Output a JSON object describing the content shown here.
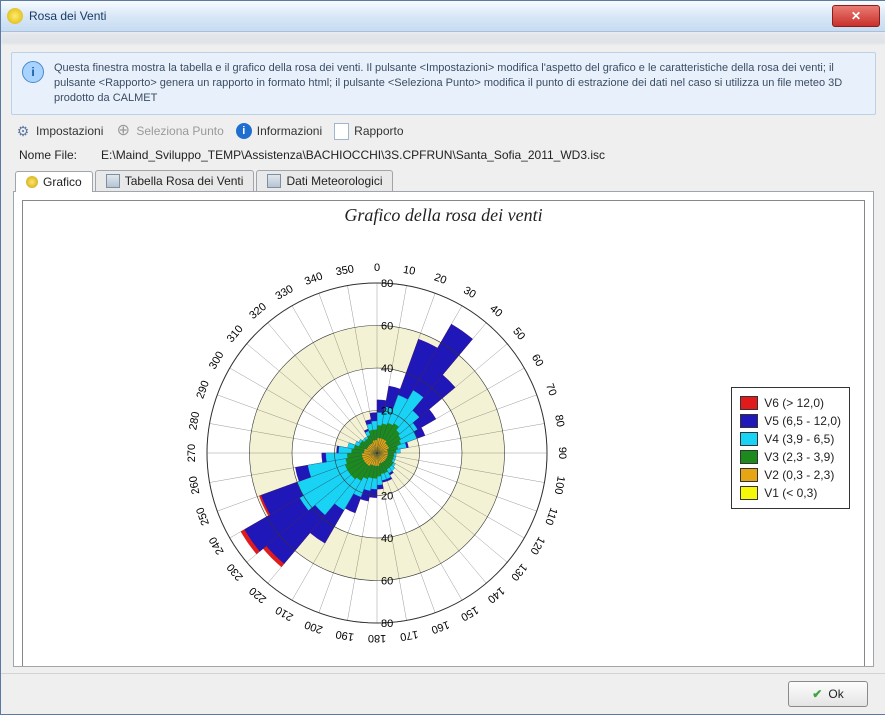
{
  "window": {
    "title": "Rosa dei Venti"
  },
  "info": {
    "text": "Questa finestra mostra la tabella e il grafico della rosa dei venti. Il pulsante <Impostazioni> modifica l'aspetto del grafico e le caratteristiche della rosa dei venti; il pulsante <Rapporto> genera un rapporto in formato html; il pulsante <Seleziona Punto> modifica il punto di estrazione dei dati nel caso si utilizza un file meteo 3D prodotto da CALMET"
  },
  "toolbar": {
    "impostazioni": "Impostazioni",
    "seleziona": "Seleziona Punto",
    "informazioni": "Informazioni",
    "rapporto": "Rapporto"
  },
  "file": {
    "label": "Nome File:",
    "path": "E:\\Maind_Sviluppo_TEMP\\Assistenza\\BACHIOCCHI\\3S.CPFRUN\\Santa_Sofia_2011_WD3.isc"
  },
  "tabs": {
    "grafico": "Grafico",
    "tabella": "Tabella Rosa dei Venti",
    "meteo": "Dati Meteorologici"
  },
  "chart_title": "Grafico della rosa dei venti",
  "legend": [
    {
      "name": "V6 (> 12,0)",
      "color": "#e11b1b"
    },
    {
      "name": "V5 (6,5 - 12,0)",
      "color": "#2017b9"
    },
    {
      "name": "V4 (3,9 - 6,5)",
      "color": "#18d3f4"
    },
    {
      "name": "V3 (2,3 - 3,9)",
      "color": "#1c8a1c"
    },
    {
      "name": "V2 (0,3 - 2,3)",
      "color": "#e6a514"
    },
    {
      "name": "V1 (< 0,3)",
      "color": "#f6f60a"
    }
  ],
  "footer": {
    "ok": "Ok"
  },
  "chart_data": {
    "type": "wind_rose",
    "title": "Grafico della rosa dei venti",
    "angular_axis": {
      "start": 0,
      "end": 355,
      "step": 10
    },
    "radial_axis": {
      "ticks": [
        20,
        40,
        60,
        80
      ],
      "max": 80
    },
    "speed_classes": [
      {
        "id": "V1",
        "label": "< 0,3",
        "color": "#f6f60a"
      },
      {
        "id": "V2",
        "label": "0,3 - 2,3",
        "color": "#e6a514"
      },
      {
        "id": "V3",
        "label": "2,3 - 3,9",
        "color": "#1c8a1c"
      },
      {
        "id": "V4",
        "label": "3,9 - 6,5",
        "color": "#18d3f4"
      },
      {
        "id": "V5",
        "label": "6,5 - 12,0",
        "color": "#2017b9"
      },
      {
        "id": "V6",
        "label": "> 12,0",
        "color": "#e11b1b"
      }
    ],
    "sectors": [
      {
        "dir": 5,
        "V1": 1,
        "V2": 6,
        "V3": 6,
        "V4": 6,
        "V5": 6,
        "V6": 0
      },
      {
        "dir": 15,
        "V1": 1,
        "V2": 6,
        "V3": 7,
        "V4": 8,
        "V5": 10,
        "V6": 0
      },
      {
        "dir": 25,
        "V1": 1,
        "V2": 6,
        "V3": 8,
        "V4": 14,
        "V5": 28,
        "V6": 0
      },
      {
        "dir": 35,
        "V1": 1,
        "V2": 6,
        "V3": 9,
        "V4": 18,
        "V5": 36,
        "V6": 0
      },
      {
        "dir": 45,
        "V1": 1,
        "V2": 5,
        "V3": 8,
        "V4": 12,
        "V5": 22,
        "V6": 0
      },
      {
        "dir": 55,
        "V1": 1,
        "V2": 5,
        "V3": 7,
        "V4": 9,
        "V5": 10,
        "V6": 0
      },
      {
        "dir": 65,
        "V1": 1,
        "V2": 5,
        "V3": 6,
        "V4": 8,
        "V5": 4,
        "V6": 0
      },
      {
        "dir": 75,
        "V1": 1,
        "V2": 4,
        "V3": 5,
        "V4": 4,
        "V5": 1,
        "V6": 0
      },
      {
        "dir": 85,
        "V1": 1,
        "V2": 4,
        "V3": 4,
        "V4": 2,
        "V5": 0,
        "V6": 0
      },
      {
        "dir": 95,
        "V1": 1,
        "V2": 4,
        "V3": 3,
        "V4": 1,
        "V5": 0,
        "V6": 0
      },
      {
        "dir": 105,
        "V1": 1,
        "V2": 4,
        "V3": 3,
        "V4": 1,
        "V5": 0,
        "V6": 0
      },
      {
        "dir": 115,
        "V1": 1,
        "V2": 4,
        "V3": 3,
        "V4": 1,
        "V5": 0,
        "V6": 0
      },
      {
        "dir": 125,
        "V1": 1,
        "V2": 4,
        "V3": 4,
        "V4": 1,
        "V5": 0,
        "V6": 0
      },
      {
        "dir": 135,
        "V1": 1,
        "V2": 4,
        "V3": 4,
        "V4": 2,
        "V5": 0,
        "V6": 0
      },
      {
        "dir": 145,
        "V1": 1,
        "V2": 4,
        "V3": 4,
        "V4": 2,
        "V5": 1,
        "V6": 0
      },
      {
        "dir": 155,
        "V1": 1,
        "V2": 4,
        "V3": 5,
        "V4": 3,
        "V5": 1,
        "V6": 0
      },
      {
        "dir": 165,
        "V1": 1,
        "V2": 4,
        "V3": 5,
        "V4": 3,
        "V5": 1,
        "V6": 0
      },
      {
        "dir": 175,
        "V1": 1,
        "V2": 5,
        "V3": 5,
        "V4": 4,
        "V5": 2,
        "V6": 0
      },
      {
        "dir": 185,
        "V1": 1,
        "V2": 5,
        "V3": 6,
        "V4": 5,
        "V5": 4,
        "V6": 0
      },
      {
        "dir": 195,
        "V1": 1,
        "V2": 5,
        "V3": 6,
        "V4": 6,
        "V5": 5,
        "V6": 0
      },
      {
        "dir": 205,
        "V1": 1,
        "V2": 5,
        "V3": 7,
        "V4": 9,
        "V5": 8,
        "V6": 0
      },
      {
        "dir": 215,
        "V1": 1,
        "V2": 6,
        "V3": 8,
        "V4": 16,
        "V5": 18,
        "V6": 0
      },
      {
        "dir": 225,
        "V1": 1,
        "V2": 6,
        "V3": 9,
        "V4": 22,
        "V5": 30,
        "V6": 2
      },
      {
        "dir": 235,
        "V1": 1,
        "V2": 6,
        "V3": 9,
        "V4": 26,
        "V5": 30,
        "V6": 2
      },
      {
        "dir": 245,
        "V1": 1,
        "V2": 6,
        "V3": 9,
        "V4": 24,
        "V5": 18,
        "V6": 1
      },
      {
        "dir": 255,
        "V1": 1,
        "V2": 6,
        "V3": 8,
        "V4": 18,
        "V5": 6,
        "V6": 0
      },
      {
        "dir": 265,
        "V1": 1,
        "V2": 6,
        "V3": 7,
        "V4": 10,
        "V5": 2,
        "V6": 0
      },
      {
        "dir": 275,
        "V1": 1,
        "V2": 5,
        "V3": 6,
        "V4": 6,
        "V5": 1,
        "V6": 0
      },
      {
        "dir": 285,
        "V1": 1,
        "V2": 5,
        "V3": 5,
        "V4": 3,
        "V5": 0,
        "V6": 0
      },
      {
        "dir": 295,
        "V1": 1,
        "V2": 4,
        "V3": 4,
        "V4": 2,
        "V5": 0,
        "V6": 0
      },
      {
        "dir": 305,
        "V1": 1,
        "V2": 4,
        "V3": 4,
        "V4": 1,
        "V5": 0,
        "V6": 0
      },
      {
        "dir": 315,
        "V1": 1,
        "V2": 4,
        "V3": 3,
        "V4": 1,
        "V5": 0,
        "V6": 0
      },
      {
        "dir": 325,
        "V1": 1,
        "V2": 4,
        "V3": 3,
        "V4": 1,
        "V5": 0,
        "V6": 0
      },
      {
        "dir": 335,
        "V1": 1,
        "V2": 4,
        "V3": 4,
        "V4": 2,
        "V5": 1,
        "V6": 0
      },
      {
        "dir": 345,
        "V1": 1,
        "V2": 5,
        "V3": 5,
        "V4": 3,
        "V5": 2,
        "V6": 0
      },
      {
        "dir": 355,
        "V1": 1,
        "V2": 5,
        "V3": 5,
        "V4": 4,
        "V5": 4,
        "V6": 0
      }
    ]
  }
}
